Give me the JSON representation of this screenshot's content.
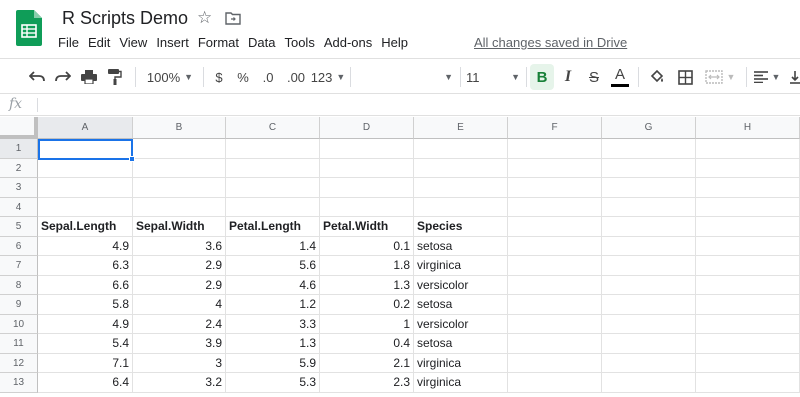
{
  "app": {
    "title": "R Scripts Demo",
    "saved_status": "All changes saved in Drive",
    "brand_color": "#0f9d58",
    "accent_color": "#1a73e8"
  },
  "menu": [
    "File",
    "Edit",
    "View",
    "Insert",
    "Format",
    "Data",
    "Tools",
    "Add-ons",
    "Help"
  ],
  "toolbar": {
    "zoom": "100%",
    "currency": "$",
    "percent": "%",
    "decrease_decimal": ".0",
    "increase_decimal": ".00",
    "more_formats": "123",
    "font_size": "11",
    "bold": "B",
    "italic": "I",
    "strikethrough": "S",
    "text_color": "A"
  },
  "formula_bar": {
    "fx": "fx",
    "value": ""
  },
  "grid": {
    "columns": [
      "A",
      "B",
      "C",
      "D",
      "E",
      "F",
      "G",
      "H"
    ],
    "rows": [
      "1",
      "2",
      "3",
      "4",
      "5",
      "6",
      "7",
      "8",
      "9",
      "10",
      "11",
      "12",
      "13"
    ],
    "selected_cell": "A1",
    "header_row": [
      "Sepal.Length",
      "Sepal.Width",
      "Petal.Length",
      "Petal.Width",
      "Species"
    ],
    "data_rows": [
      [
        "4.9",
        "3.6",
        "1.4",
        "0.1",
        "setosa"
      ],
      [
        "6.3",
        "2.9",
        "5.6",
        "1.8",
        "virginica"
      ],
      [
        "6.6",
        "2.9",
        "4.6",
        "1.3",
        "versicolor"
      ],
      [
        "5.8",
        "4",
        "1.2",
        "0.2",
        "setosa"
      ],
      [
        "4.9",
        "2.4",
        "3.3",
        "1",
        "versicolor"
      ],
      [
        "5.4",
        "3.9",
        "1.3",
        "0.4",
        "setosa"
      ],
      [
        "7.1",
        "3",
        "5.9",
        "2.1",
        "virginica"
      ],
      [
        "6.4",
        "3.2",
        "5.3",
        "2.3",
        "virginica"
      ]
    ]
  }
}
